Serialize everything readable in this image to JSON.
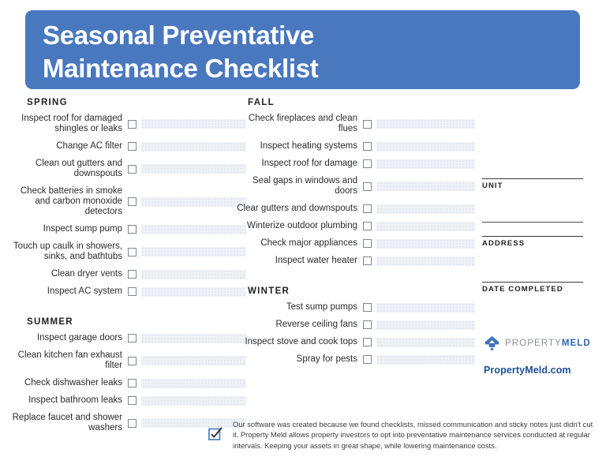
{
  "header": {
    "title": "Seasonal Preventative\nMaintenance Checklist"
  },
  "sections": {
    "spring": {
      "title": "SPRING",
      "items": [
        "Inspect roof for damaged shingles or leaks",
        "Change AC filter",
        "Clean out gutters and downspouts",
        "Check batteries in smoke and carbon monoxide detectors",
        "Inspect sump pump",
        "Touch up caulk in showers, sinks, and bathtubs",
        "Clean dryer vents",
        "Inspect AC system"
      ]
    },
    "summer": {
      "title": "SUMMER",
      "items": [
        "Inspect garage doors",
        "Clean kitchen fan exhaust filter",
        "Check dishwasher leaks",
        "Inspect bathroom leaks",
        "Replace faucet and shower washers"
      ]
    },
    "fall": {
      "title": "FALL",
      "items": [
        "Check fireplaces and clean flues",
        "Inspect heating systems",
        "Inspect roof for damage",
        "Seal gaps in windows and doors",
        "Clear gutters and downspouts",
        "Winterize outdoor plumbing",
        "Check major appliances",
        "Inspect water heater"
      ]
    },
    "winter": {
      "title": "WINTER",
      "items": [
        "Test sump pumps",
        "Reverse ceiling fans",
        "Inspect stove and cook tops",
        "Spray for pests"
      ]
    }
  },
  "form": {
    "unit_label": "UNIT",
    "address_label": "ADDRESS",
    "date_label": "DATE COMPLETED"
  },
  "logo": {
    "word_one": "PROPERTY",
    "word_two": "MELD",
    "url": "PropertyMeld.com"
  },
  "footer": {
    "text": "Our software was created because we found checklists, missed communication and sticky notes just didn't cut it. Property Meld allows property investors to opt into preventative maintenance services conducted at regular intervals. Keeping your assets in great shape, while lowering maintenance costs."
  },
  "colors": {
    "banner_blue": "#4a78bf",
    "logo_blue": "#2f67b1",
    "url_blue": "#1f4f96",
    "fill_band": "#eef2f7"
  }
}
